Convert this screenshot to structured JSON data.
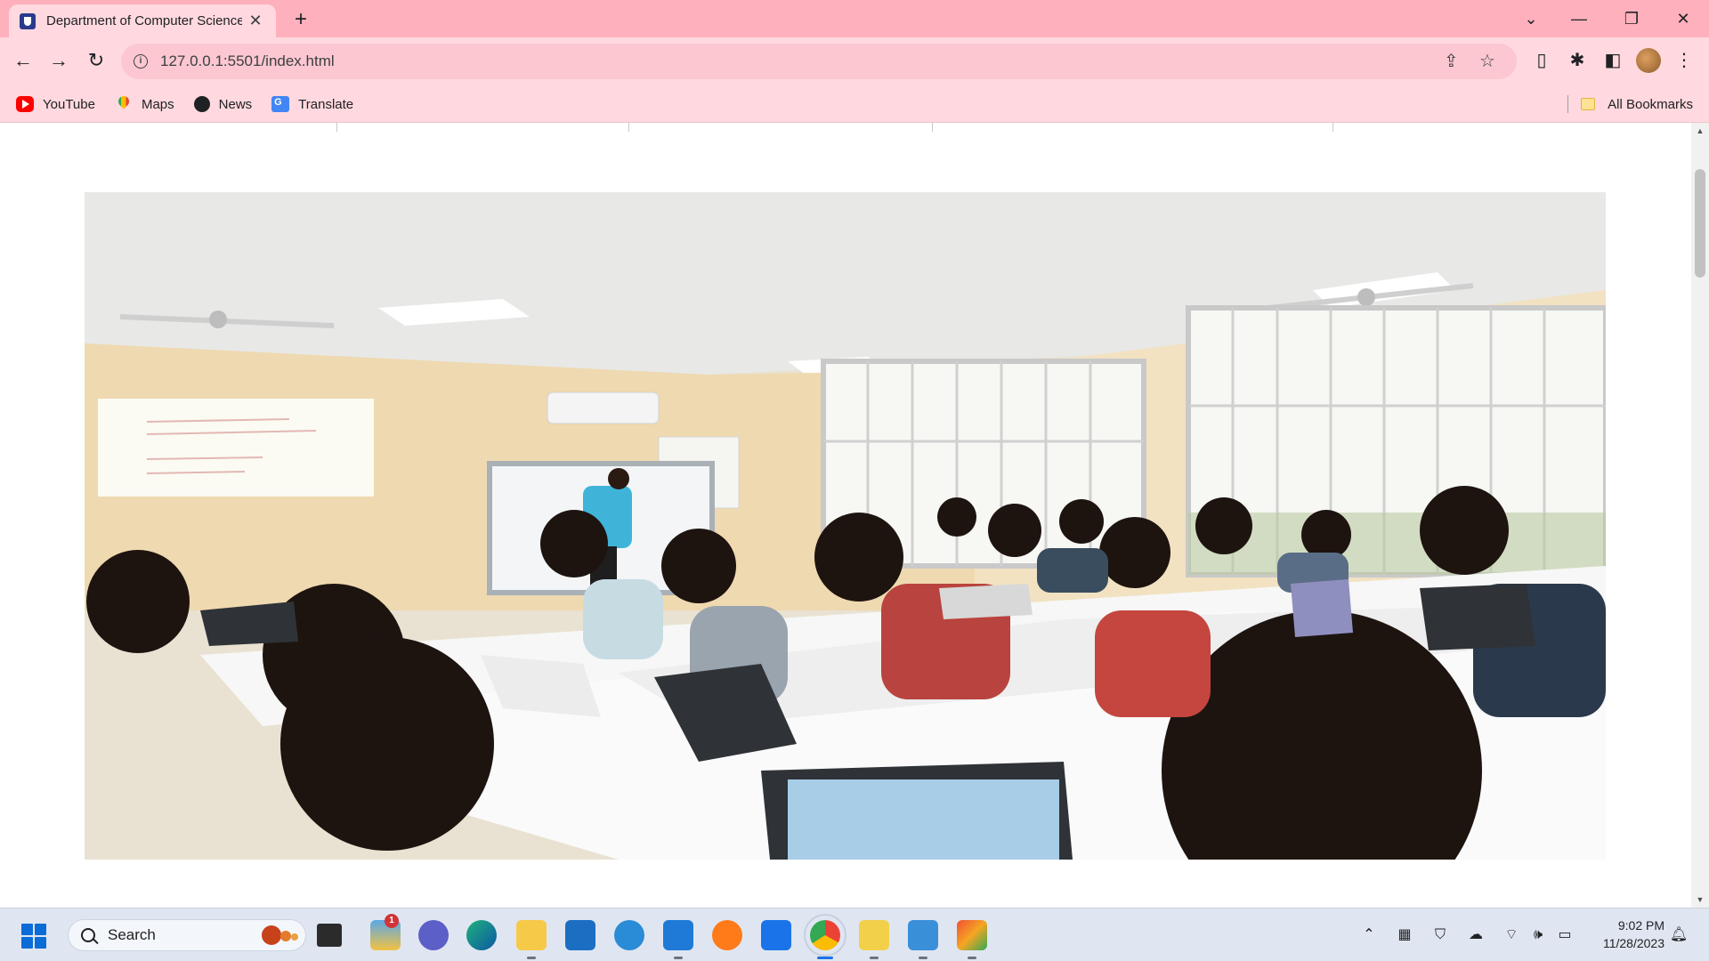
{
  "browser": {
    "tab_title": "Department of Computer Science",
    "tab_close": "✕",
    "new_tab": "+",
    "url": "127.0.0.1:5501/index.html",
    "window_controls": {
      "tab_search": "⌄",
      "minimize": "—",
      "restore": "❐",
      "close": "✕"
    },
    "nav": {
      "back": "←",
      "forward": "→",
      "reload": "↻"
    }
  },
  "bookmarks": [
    {
      "label": "YouTube",
      "icon": "youtube-icon"
    },
    {
      "label": "Maps",
      "icon": "maps-icon"
    },
    {
      "label": "News",
      "icon": "news-icon"
    },
    {
      "label": "Translate",
      "icon": "translate-icon"
    }
  ],
  "all_bookmarks_label": "All Bookmarks",
  "page": {
    "hero_image": "classroom-photo"
  },
  "taskbar": {
    "search_label": "Search",
    "notification_count": "1",
    "time": "9:02 PM",
    "date": "11/28/2023"
  },
  "colors": {
    "titlebar": "#ffb0bd",
    "toolbar": "#ffd9df",
    "omnibox": "#fcc7d0",
    "taskbar": "#dfe6f1"
  }
}
